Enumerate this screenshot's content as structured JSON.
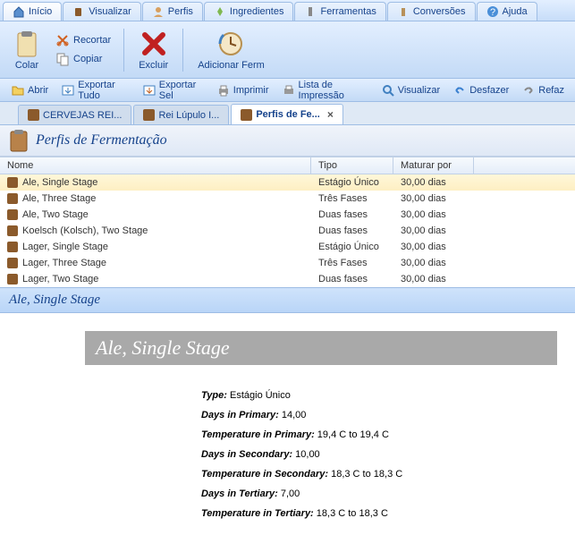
{
  "main_tabs": {
    "inicio": "Início",
    "visualizar": "Visualizar",
    "perfis": "Perfis",
    "ingredientes": "Ingredientes",
    "ferramentas": "Ferramentas",
    "conversoes": "Conversões",
    "ajuda": "Ajuda"
  },
  "ribbon": {
    "colar": "Colar",
    "recortar": "Recortar",
    "copiar": "Copiar",
    "excluir": "Excluir",
    "adicionar_ferm": "Adicionar Ferm"
  },
  "quickbar": {
    "abrir": "Abrir",
    "exportar_tudo": "Exportar Tudo",
    "exportar_sel": "Exportar Sel",
    "imprimir": "Imprimir",
    "lista_impressao": "Lista de Impressão",
    "visualizar": "Visualizar",
    "desfazer": "Desfazer",
    "refazer": "Refaz"
  },
  "doc_tabs": {
    "tab0": "CERVEJAS REI...",
    "tab1": "Rei Lúpulo I...",
    "tab2": "Perfis de Fe..."
  },
  "view_title": "Perfis de Fermentação",
  "grid": {
    "headers": {
      "nome": "Nome",
      "tipo": "Tipo",
      "maturar": "Maturar por"
    },
    "rows": [
      {
        "nome": "Ale, Single Stage",
        "tipo": "Estágio Único",
        "maturar": "30,00 dias"
      },
      {
        "nome": "Ale, Three Stage",
        "tipo": "Três Fases",
        "maturar": "30,00 dias"
      },
      {
        "nome": "Ale, Two Stage",
        "tipo": "Duas fases",
        "maturar": "30,00 dias"
      },
      {
        "nome": "Koelsch (Kolsch), Two Stage",
        "tipo": "Duas fases",
        "maturar": "30,00 dias"
      },
      {
        "nome": "Lager, Single Stage",
        "tipo": "Estágio Único",
        "maturar": "30,00 dias"
      },
      {
        "nome": "Lager, Three Stage",
        "tipo": "Três Fases",
        "maturar": "30,00 dias"
      },
      {
        "nome": "Lager, Two Stage",
        "tipo": "Duas fases",
        "maturar": "30,00 dias"
      }
    ]
  },
  "detail": {
    "header": "Ale, Single Stage",
    "title": "Ale, Single Stage",
    "fields": {
      "type_lbl": "Type:",
      "type_val": " Estágio Único",
      "dprim_lbl": "Days in Primary:",
      "dprim_val": " 14,00",
      "tprim_lbl": "Temperature in Primary:",
      "tprim_val": " 19,4 C to 19,4 C",
      "dsec_lbl": "Days in Secondary:",
      "dsec_val": " 10,00",
      "tsec_lbl": "Temperature in Secondary:",
      "tsec_val": " 18,3 C to 18,3 C",
      "dter_lbl": "Days in Tertiary:",
      "dter_val": " 7,00",
      "tter_lbl": "Temperature in Tertiary:",
      "tter_val": " 18,3 C to 18,3 C"
    }
  }
}
